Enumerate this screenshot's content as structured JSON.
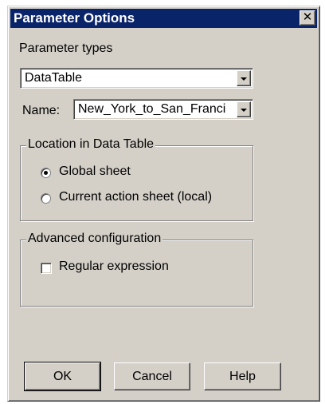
{
  "dialog": {
    "title": "Parameter Options",
    "close_glyph": "✕",
    "parameter_types_label": "Parameter types",
    "parameter_type_value": "DataTable",
    "name_label": "Name:",
    "name_value": "New_York_to_San_Franci",
    "location_group": {
      "title": "Location in Data Table",
      "options": [
        {
          "label": "Global sheet",
          "selected": true
        },
        {
          "label": "Current action sheet (local)",
          "selected": false
        }
      ]
    },
    "advanced_group": {
      "title": "Advanced configuration",
      "regular_expression_label": "Regular expression",
      "regular_expression_checked": false
    },
    "buttons": {
      "ok": "OK",
      "cancel": "Cancel",
      "help": "Help"
    }
  }
}
